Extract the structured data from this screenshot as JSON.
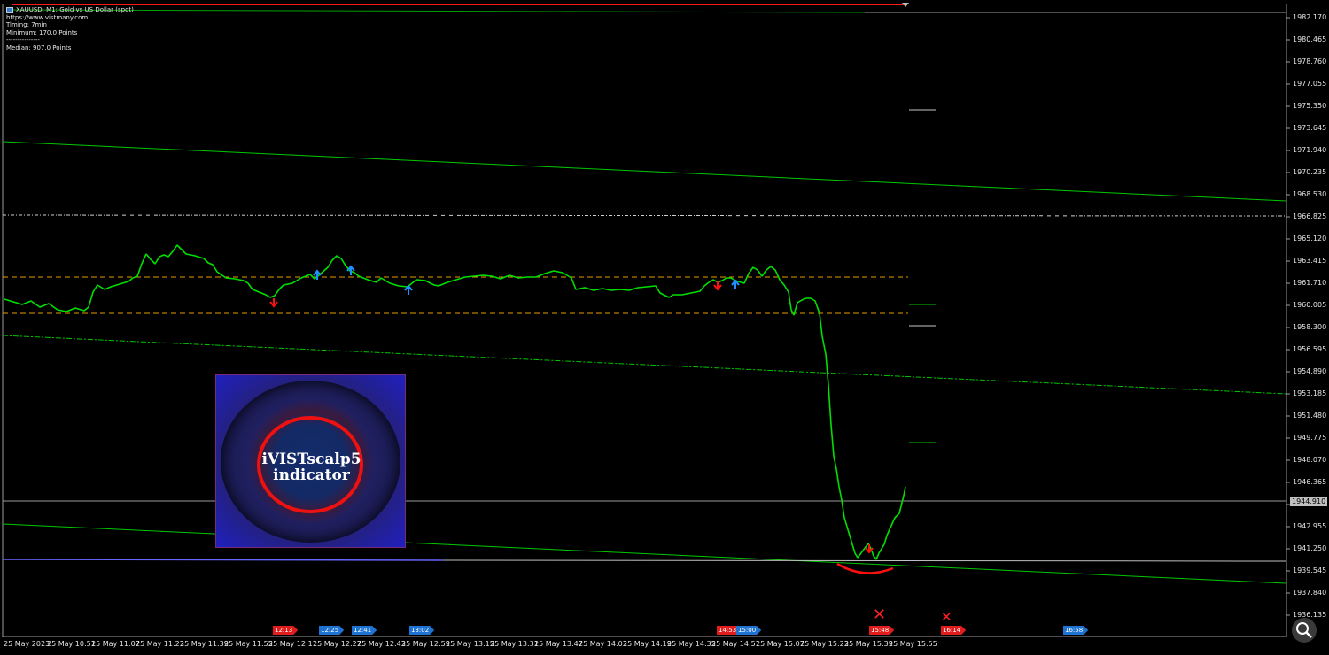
{
  "chart": {
    "title": "XAUUSD, M1: Gold vs US Dollar (spot)",
    "info_lines": [
      "https://www.vistmany.com",
      "Timing: 7min",
      "Minimum: 170.0 Points",
      "---------------",
      "Median: 907.0 Points"
    ],
    "current_price": "1944.910",
    "colors": {
      "background": "#000000",
      "candle": "#00e000",
      "channel": "#00c800",
      "level": "#e69a00",
      "buy_arrow": "#1e90ff",
      "sell_arrow": "#ff1010",
      "text": "#e6e6e6"
    }
  },
  "price_axis": {
    "labels": [
      "1982.170",
      "1980.465",
      "1978.760",
      "1977.055",
      "1975.350",
      "1973.645",
      "1971.940",
      "1970.235",
      "1968.530",
      "1966.825",
      "1965.120",
      "1963.415",
      "1961.710",
      "1960.005",
      "1958.300",
      "1956.595",
      "1954.890",
      "1953.185",
      "1951.480",
      "1949.775",
      "1948.070",
      "1946.365",
      "1944.660",
      "1942.955",
      "1941.250",
      "1939.545",
      "1937.840",
      "1936.135"
    ]
  },
  "time_axis": {
    "labels": [
      "25 May 2023",
      "25 May 10:51",
      "25 May 11:07",
      "25 May 11:23",
      "25 May 11:39",
      "25 May 11:55",
      "25 May 12:11",
      "25 May 12:27",
      "25 May 12:43",
      "25 May 12:59",
      "25 May 13:15",
      "25 May 13:31",
      "25 May 13:47",
      "25 May 14:03",
      "25 May 14:19",
      "25 May 14:35",
      "25 May 14:51",
      "25 May 15:07",
      "25 May 15:23",
      "25 May 15:39",
      "25 May 15:55"
    ]
  },
  "time_markers": [
    {
      "label": "12:13",
      "kind": "sell"
    },
    {
      "label": "12:25",
      "kind": "buy"
    },
    {
      "label": "12:41",
      "kind": "buy"
    },
    {
      "label": "13:02",
      "kind": "buy"
    },
    {
      "label": "14:53",
      "kind": "sell"
    },
    {
      "label": "15:00",
      "kind": "buy"
    },
    {
      "label": "15:48",
      "kind": "sell"
    },
    {
      "label": "16:14",
      "kind": "sell"
    },
    {
      "label": "16:58",
      "kind": "buy"
    }
  ],
  "overlay": {
    "line1": "iVISTscalp5",
    "line2": "indicator"
  },
  "icons": {
    "zoom": "magnifier-icon",
    "symbol": "chart-symbol-icon",
    "cancel_mark": "x-mark-icon"
  }
}
